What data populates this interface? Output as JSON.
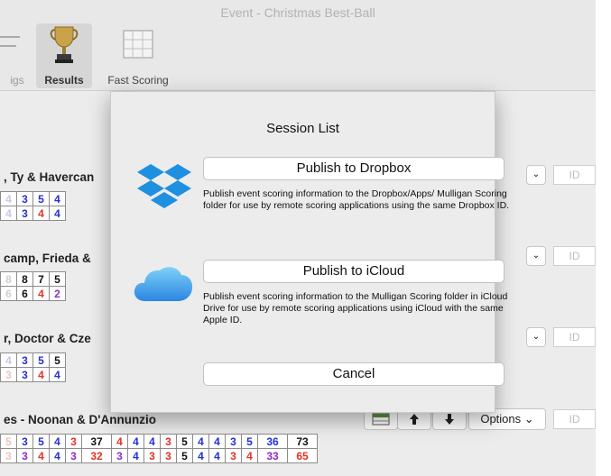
{
  "window": {
    "title": "Event - Christmas Best-Ball"
  },
  "toolbar": {
    "items": [
      {
        "label": "igs"
      },
      {
        "label": "Results"
      },
      {
        "label": "Fast Scoring"
      }
    ]
  },
  "teams": [
    {
      "name": ", Ty & Havercan",
      "row1": [
        "4",
        "3",
        "5",
        "4"
      ],
      "row2": [
        "4",
        "3",
        "4",
        "4"
      ]
    },
    {
      "name": "camp, Frieda &",
      "row1": [
        "8",
        "8",
        "7",
        "5"
      ],
      "row2": [
        "6",
        "6",
        "4",
        "2"
      ]
    },
    {
      "name": "r, Doctor & Cze",
      "row1": [
        "4",
        "3",
        "5",
        "5"
      ],
      "row2": [
        "3",
        "3",
        "4",
        "4"
      ]
    },
    {
      "name": "es - Noonan & D'Annunzio",
      "row1": [
        "5",
        "3",
        "5",
        "4",
        "3",
        "37",
        "4",
        "4",
        "4",
        "3",
        "5",
        "4",
        "4",
        "3",
        "5",
        "36",
        "73"
      ],
      "row2": [
        "3",
        "3",
        "4",
        "4",
        "3",
        "32",
        "3",
        "4",
        "3",
        "3",
        "5",
        "4",
        "4",
        "3",
        "4",
        "33",
        "65"
      ]
    }
  ],
  "controls": {
    "id_placeholder": "ID",
    "options_label": "Options",
    "chevron": "⌄"
  },
  "dialog": {
    "title": "Session List",
    "dropbox_button": "Publish to Dropbox",
    "dropbox_desc": "Publish event scoring information to the Dropbox/Apps/ Mulligan Scoring folder for use by remote scoring applications using the same Dropbox ID.",
    "icloud_button": "Publish to iCloud",
    "icloud_desc": "Publish event scoring information to the Mulligan Scoring folder in iCloud Drive for use by remote scoring applications using iCloud with the same Apple ID.",
    "cancel_button": "Cancel"
  }
}
